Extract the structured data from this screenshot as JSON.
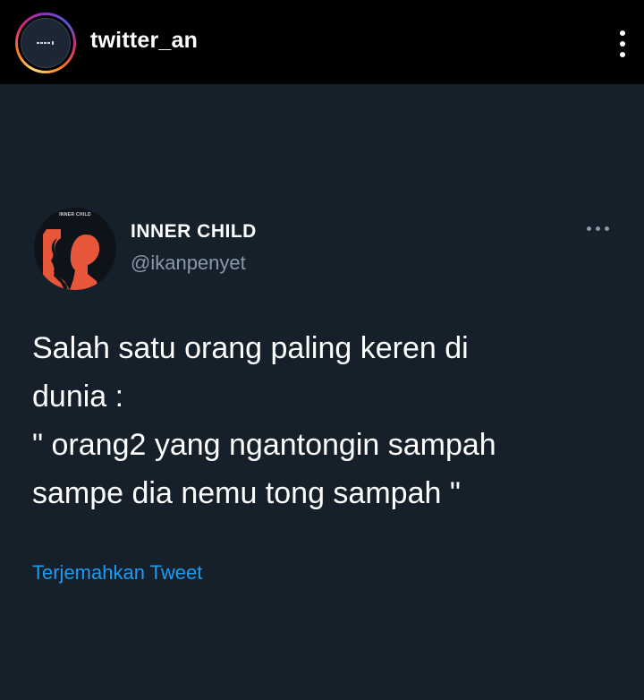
{
  "header": {
    "username": "twitter_an",
    "menu_icon": "more-vertical-icon"
  },
  "tweet": {
    "avatar_label": "INNER CHILD",
    "display_name": "INNER CHILD",
    "handle": "@ikanpenyet",
    "menu_icon": "more-horizontal-icon",
    "text": "Salah satu orang paling keren di\ndunia :\n\" orang2 yang ngantongin sampah\nsampe dia nemu tong sampah \"",
    "translate_label": "Terjemahkan Tweet"
  },
  "colors": {
    "background": "#15202b",
    "topbar": "#000000",
    "link": "#1d9bf0",
    "secondary_text": "#8899a6",
    "avatar_accent": "#e8563a"
  }
}
